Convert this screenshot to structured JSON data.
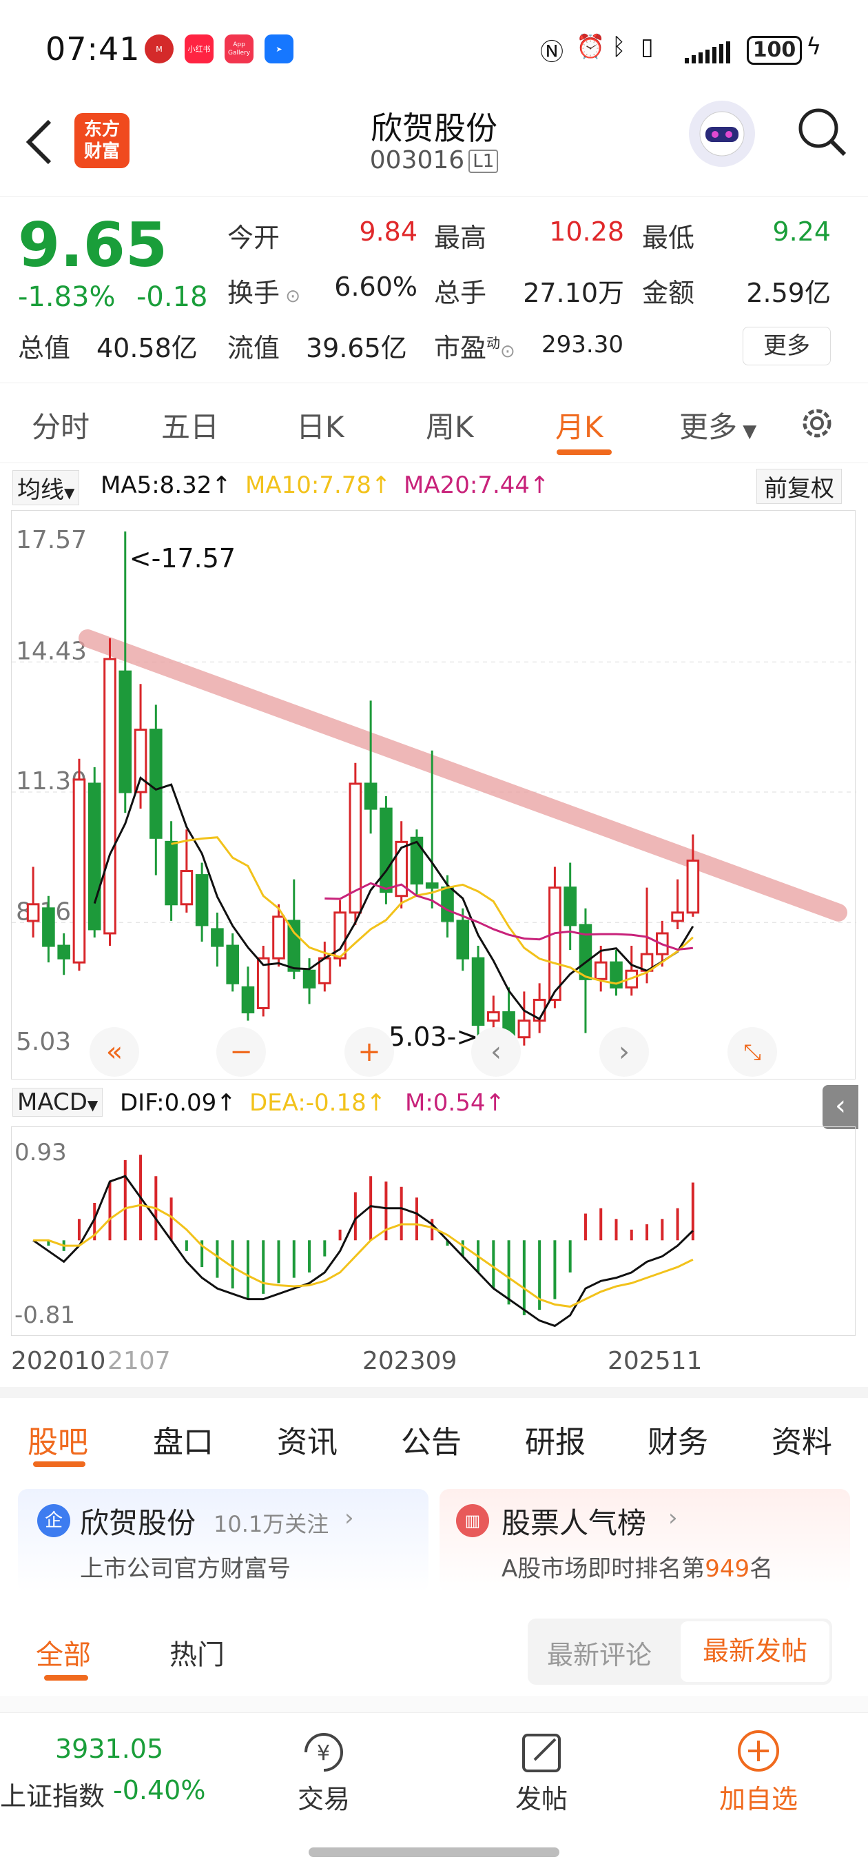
{
  "status_bar": {
    "time": "07:41",
    "app_icon_labels": [
      "小红书",
      "App Gallery"
    ],
    "battery": "100"
  },
  "header": {
    "logo_text": "东方\n财富",
    "stock_name": "欣贺股份",
    "stock_code": "003016",
    "level": "L1"
  },
  "quote": {
    "price": "9.65",
    "change_pct": "-1.83%",
    "change": "-0.18",
    "open_label": "今开",
    "open": "9.84",
    "high_label": "最高",
    "high": "10.28",
    "low_label": "最低",
    "low": "9.24",
    "turnover_label": "换手",
    "turnover": "6.60%",
    "volume_label": "总手",
    "volume": "27.10万",
    "amount_label": "金额",
    "amount": "2.59亿",
    "mcap_label": "总值",
    "mcap": "40.58亿",
    "float_label": "流值",
    "float": "39.65亿",
    "pe_label": "市盈",
    "pe_sup": "动",
    "pe": "293.30",
    "more": "更多"
  },
  "period_tabs": {
    "items": [
      "分时",
      "五日",
      "日K",
      "周K",
      "月K",
      "更多"
    ],
    "active": "月K"
  },
  "ma_bar": {
    "selector": "均线",
    "ma5": "MA5:8.32↑",
    "ma10": "MA10:7.78↑",
    "ma20": "MA20:7.44↑",
    "adjust": "前复权",
    "ma5_color": "#111111",
    "ma10_color": "#f2c21b",
    "ma20_color": "#c8227a"
  },
  "macd_bar": {
    "selector": "MACD",
    "dif": "DIF:0.09↑",
    "dea": "DEA:-0.18↑",
    "m": "M:0.54↑"
  },
  "chart_data": [
    {
      "type": "candlestick",
      "y_tick_labels": [
        "17.57",
        "14.43",
        "11.30",
        "8.16",
        "5.03"
      ],
      "ylim": [
        5.03,
        17.57
      ],
      "annotations": [
        "<-17.57",
        "5.03->"
      ],
      "x_tick_labels": [
        "202010",
        "2107",
        "202309",
        "202511"
      ],
      "candles": [
        {
          "o": 8.2,
          "c": 8.6,
          "h": 9.5,
          "l": 7.8
        },
        {
          "o": 8.5,
          "c": 7.6,
          "h": 8.8,
          "l": 7.2
        },
        {
          "o": 7.6,
          "c": 7.3,
          "h": 7.9,
          "l": 6.9
        },
        {
          "o": 7.2,
          "c": 11.6,
          "h": 12.1,
          "l": 7.0
        },
        {
          "o": 11.5,
          "c": 8.0,
          "h": 11.9,
          "l": 7.8
        },
        {
          "o": 7.9,
          "c": 14.5,
          "h": 15.0,
          "l": 7.6
        },
        {
          "o": 14.2,
          "c": 11.3,
          "h": 17.57,
          "l": 10.8
        },
        {
          "o": 11.3,
          "c": 12.8,
          "h": 13.9,
          "l": 10.9
        },
        {
          "o": 12.8,
          "c": 10.2,
          "h": 13.4,
          "l": 9.3
        },
        {
          "o": 10.1,
          "c": 8.6,
          "h": 10.6,
          "l": 8.2
        },
        {
          "o": 8.6,
          "c": 9.4,
          "h": 10.4,
          "l": 8.4
        },
        {
          "o": 9.3,
          "c": 8.1,
          "h": 9.6,
          "l": 7.7
        },
        {
          "o": 8.0,
          "c": 7.6,
          "h": 8.4,
          "l": 7.1
        },
        {
          "o": 7.6,
          "c": 6.7,
          "h": 7.9,
          "l": 6.5
        },
        {
          "o": 6.6,
          "c": 6.0,
          "h": 7.1,
          "l": 5.8
        },
        {
          "o": 6.1,
          "c": 7.3,
          "h": 7.6,
          "l": 5.9
        },
        {
          "o": 7.3,
          "c": 8.3,
          "h": 8.6,
          "l": 7.1
        },
        {
          "o": 8.2,
          "c": 7.0,
          "h": 9.2,
          "l": 6.8
        },
        {
          "o": 7.0,
          "c": 6.6,
          "h": 7.3,
          "l": 6.2
        },
        {
          "o": 6.7,
          "c": 7.3,
          "h": 7.7,
          "l": 6.5
        },
        {
          "o": 7.3,
          "c": 8.4,
          "h": 8.7,
          "l": 7.1
        },
        {
          "o": 8.4,
          "c": 11.5,
          "h": 12.0,
          "l": 8.1
        },
        {
          "o": 11.5,
          "c": 10.9,
          "h": 13.5,
          "l": 10.3
        },
        {
          "o": 10.9,
          "c": 8.9,
          "h": 11.2,
          "l": 8.6
        },
        {
          "o": 8.8,
          "c": 10.1,
          "h": 10.6,
          "l": 8.5
        },
        {
          "o": 10.2,
          "c": 9.1,
          "h": 10.4,
          "l": 8.8
        },
        {
          "o": 9.1,
          "c": 9.0,
          "h": 12.3,
          "l": 8.5
        },
        {
          "o": 9.0,
          "c": 8.2,
          "h": 9.3,
          "l": 7.8
        },
        {
          "o": 8.2,
          "c": 7.3,
          "h": 8.5,
          "l": 7.0
        },
        {
          "o": 7.3,
          "c": 5.7,
          "h": 7.6,
          "l": 5.03
        },
        {
          "o": 5.8,
          "c": 6.0,
          "h": 6.4,
          "l": 5.5
        },
        {
          "o": 6.0,
          "c": 5.4,
          "h": 6.6,
          "l": 5.2
        },
        {
          "o": 5.4,
          "c": 5.8,
          "h": 6.5,
          "l": 5.2
        },
        {
          "o": 5.8,
          "c": 6.3,
          "h": 6.7,
          "l": 5.5
        },
        {
          "o": 6.3,
          "c": 9.0,
          "h": 9.5,
          "l": 6.1
        },
        {
          "o": 9.0,
          "c": 8.1,
          "h": 9.6,
          "l": 7.5
        },
        {
          "o": 8.1,
          "c": 6.8,
          "h": 8.5,
          "l": 5.5
        },
        {
          "o": 6.8,
          "c": 7.2,
          "h": 7.6,
          "l": 6.5
        },
        {
          "o": 7.2,
          "c": 6.6,
          "h": 7.5,
          "l": 6.4
        },
        {
          "o": 6.6,
          "c": 7.0,
          "h": 7.6,
          "l": 6.4
        },
        {
          "o": 7.0,
          "c": 7.4,
          "h": 9.0,
          "l": 6.7
        },
        {
          "o": 7.4,
          "c": 7.9,
          "h": 8.2,
          "l": 7.1
        },
        {
          "o": 8.2,
          "c": 8.4,
          "h": 9.2,
          "l": 8.0
        },
        {
          "o": 8.4,
          "c": 9.65,
          "h": 10.28,
          "l": 8.3
        }
      ]
    },
    {
      "type": "bar",
      "title": "MACD",
      "y_tick_labels": [
        "0.93",
        "-0.81"
      ],
      "ylim": [
        -0.81,
        0.93
      ],
      "m_values": [
        0.0,
        -0.05,
        -0.1,
        0.2,
        0.35,
        0.55,
        0.75,
        0.8,
        0.6,
        0.4,
        -0.1,
        -0.25,
        -0.35,
        -0.45,
        -0.55,
        -0.5,
        -0.4,
        -0.35,
        -0.3,
        -0.15,
        0.1,
        0.45,
        0.6,
        0.55,
        0.5,
        0.4,
        0.2,
        -0.05,
        -0.15,
        -0.3,
        -0.45,
        -0.6,
        -0.7,
        -0.65,
        -0.55,
        -0.3,
        0.25,
        0.3,
        0.2,
        0.1,
        0.15,
        0.2,
        0.3,
        0.54
      ],
      "dif": [
        0.0,
        -0.1,
        -0.2,
        -0.05,
        0.2,
        0.55,
        0.6,
        0.4,
        0.2,
        0.0,
        -0.2,
        -0.35,
        -0.45,
        -0.5,
        -0.55,
        -0.55,
        -0.5,
        -0.45,
        -0.4,
        -0.3,
        -0.1,
        0.2,
        0.32,
        0.3,
        0.3,
        0.25,
        0.15,
        0.0,
        -0.15,
        -0.3,
        -0.45,
        -0.55,
        -0.65,
        -0.75,
        -0.8,
        -0.7,
        -0.45,
        -0.38,
        -0.35,
        -0.3,
        -0.2,
        -0.15,
        -0.05,
        0.09
      ],
      "dea": [
        0.0,
        0.0,
        -0.05,
        -0.05,
        0.05,
        0.2,
        0.3,
        0.33,
        0.3,
        0.22,
        0.1,
        -0.05,
        -0.15,
        -0.25,
        -0.33,
        -0.4,
        -0.42,
        -0.43,
        -0.42,
        -0.38,
        -0.3,
        -0.15,
        0.0,
        0.1,
        0.15,
        0.15,
        0.12,
        0.05,
        -0.05,
        -0.15,
        -0.25,
        -0.35,
        -0.45,
        -0.55,
        -0.6,
        -0.62,
        -0.55,
        -0.48,
        -0.43,
        -0.4,
        -0.35,
        -0.3,
        -0.25,
        -0.18
      ]
    }
  ],
  "section_tabs": {
    "items": [
      "股吧",
      "盘口",
      "资讯",
      "公告",
      "研报",
      "财务",
      "资料"
    ],
    "active": "股吧"
  },
  "cards": {
    "left_badge": "企",
    "left_title": "欣贺股份",
    "left_followers": "10.1万关注",
    "left_sub": "上市公司官方财富号",
    "right_title": "股票人气榜",
    "right_sub_prefix": "A股市场即时排名第",
    "right_rank": "949",
    "right_sub_suffix": "名"
  },
  "filter": {
    "all": "全部",
    "hot": "热门",
    "latest_comment": "最新评论",
    "latest_post": "最新发帖"
  },
  "bottom_nav": {
    "index_value": "3931.05",
    "index_name": "上证指数",
    "index_change": "-0.40%",
    "trade": "交易",
    "post": "发帖",
    "add_watch": "加自选"
  }
}
